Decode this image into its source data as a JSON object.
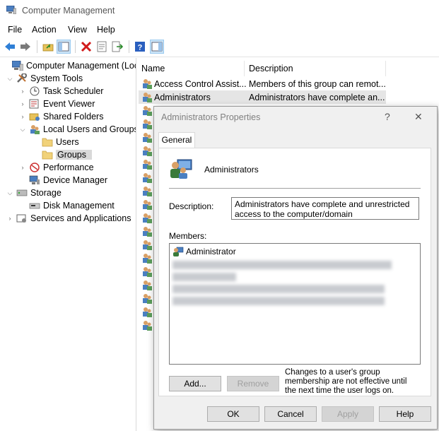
{
  "window": {
    "title": "Computer Management"
  },
  "menu": [
    "File",
    "Action",
    "View",
    "Help"
  ],
  "toolbar": [
    "back-icon",
    "forward-icon",
    "up-folder-icon",
    "show-hide-tree-icon",
    "delete-icon",
    "properties-icon",
    "export-icon",
    "help-icon",
    "action-pane-icon"
  ],
  "tree": {
    "root": "Computer Management (Local",
    "system_tools": "System Tools",
    "task_scheduler": "Task Scheduler",
    "event_viewer": "Event Viewer",
    "shared_folders": "Shared Folders",
    "local_users_groups": "Local Users and Groups",
    "users": "Users",
    "groups": "Groups",
    "performance": "Performance",
    "device_manager": "Device Manager",
    "storage": "Storage",
    "disk_management": "Disk Management",
    "services_apps": "Services and Applications"
  },
  "list": {
    "col_name": "Name",
    "col_description": "Description",
    "rows": [
      {
        "name": "Access Control Assist...",
        "description": "Members of this group can remot..."
      },
      {
        "name": "Administrators",
        "description": "Administrators have complete an..."
      }
    ]
  },
  "dialog": {
    "title": "Administrators Properties",
    "help_glyph": "?",
    "close_glyph": "✕",
    "tab": "General",
    "group_name": "Administrators",
    "description_label": "Description:",
    "description_value": "Administrators have complete and unrestricted access to the computer/domain",
    "members_label": "Members:",
    "members": [
      "Administrator"
    ],
    "add_button": "Add...",
    "remove_button": "Remove",
    "note": "Changes to a user's group membership are not effective until the next time the user logs on.",
    "ok": "OK",
    "cancel": "Cancel",
    "apply": "Apply",
    "help": "Help"
  }
}
